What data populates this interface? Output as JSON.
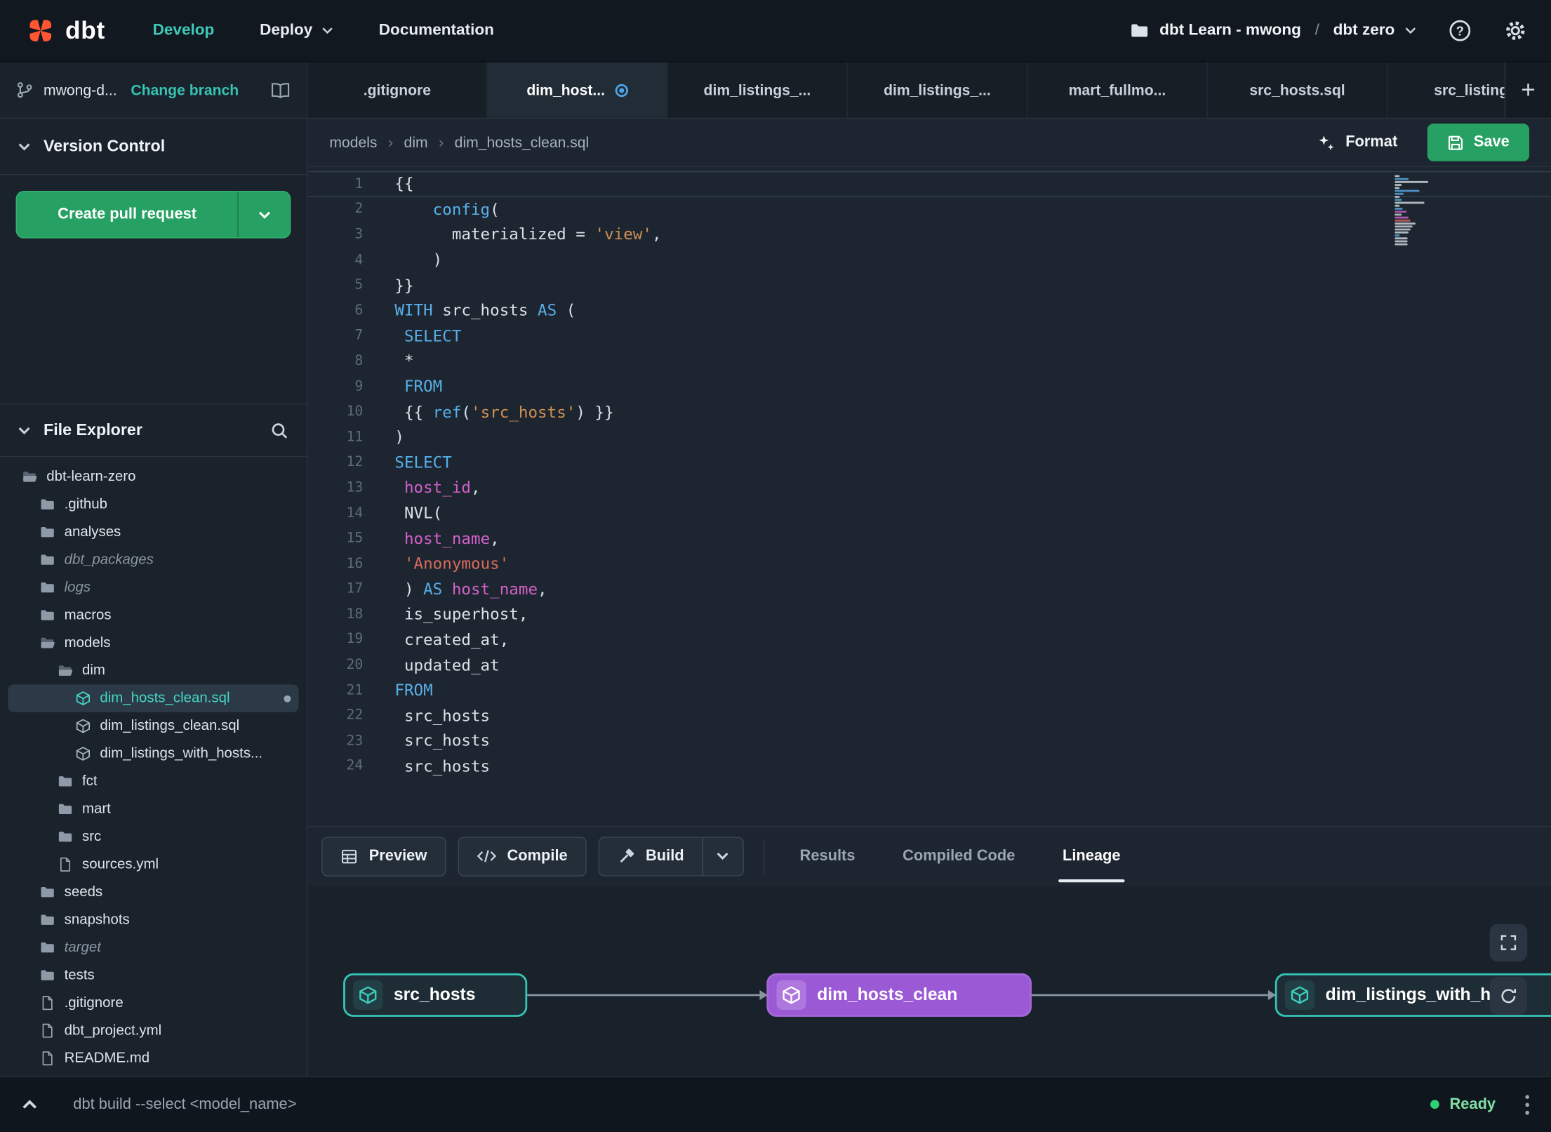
{
  "topnav": {
    "logo": "dbt",
    "develop": "Develop",
    "deploy": "Deploy",
    "documentation": "Documentation",
    "account": "dbt Learn - mwong",
    "separator": "/",
    "project": "dbt zero"
  },
  "sidebar": {
    "branch_name": "mwong-d...",
    "change_branch": "Change branch",
    "version_control": "Version Control",
    "create_pull_request": "Create pull request",
    "file_explorer": "File Explorer",
    "file_tree": [
      {
        "label": "dbt-learn-zero",
        "icon": "folderOpen",
        "indent": 0
      },
      {
        "label": ".github",
        "icon": "folder",
        "indent": 1
      },
      {
        "label": "analyses",
        "icon": "folder",
        "indent": 1
      },
      {
        "label": "dbt_packages",
        "icon": "folder",
        "indent": 1,
        "muted": true
      },
      {
        "label": "logs",
        "icon": "folder",
        "indent": 1,
        "muted": true
      },
      {
        "label": "macros",
        "icon": "folder",
        "indent": 1
      },
      {
        "label": "models",
        "icon": "folderOpen",
        "indent": 1
      },
      {
        "label": "dim",
        "icon": "folderOpen",
        "indent": 2
      },
      {
        "label": "dim_hosts_clean.sql",
        "icon": "model",
        "indent": 3,
        "selected": true,
        "unsaved": true
      },
      {
        "label": "dim_listings_clean.sql",
        "icon": "model",
        "indent": 3
      },
      {
        "label": "dim_listings_with_hosts...",
        "icon": "model",
        "indent": 3
      },
      {
        "label": "fct",
        "icon": "folder",
        "indent": 2
      },
      {
        "label": "mart",
        "icon": "folder",
        "indent": 2
      },
      {
        "label": "src",
        "icon": "folder",
        "indent": 2
      },
      {
        "label": "sources.yml",
        "icon": "file",
        "indent": 2
      },
      {
        "label": "seeds",
        "icon": "folder",
        "indent": 1
      },
      {
        "label": "snapshots",
        "icon": "folder",
        "indent": 1
      },
      {
        "label": "target",
        "icon": "folder",
        "indent": 1,
        "muted": true
      },
      {
        "label": "tests",
        "icon": "folder",
        "indent": 1
      },
      {
        "label": ".gitignore",
        "icon": "file",
        "indent": 1
      },
      {
        "label": "dbt_project.yml",
        "icon": "file",
        "indent": 1
      },
      {
        "label": "README.md",
        "icon": "file",
        "indent": 1
      }
    ]
  },
  "tabs": [
    {
      "label": ".gitignore"
    },
    {
      "label": "dim_host...",
      "active": true,
      "unsaved": true
    },
    {
      "label": "dim_listings_..."
    },
    {
      "label": "dim_listings_..."
    },
    {
      "label": "mart_fullmo..."
    },
    {
      "label": "src_hosts.sql"
    },
    {
      "label": "src_listings."
    }
  ],
  "breadcrumb": [
    "models",
    "dim",
    "dim_hosts_clean.sql"
  ],
  "actions": {
    "format": "Format",
    "save": "Save"
  },
  "editor": {
    "lines": [
      [
        [
          "{{",
          "p"
        ]
      ],
      [
        [
          "    ",
          "p"
        ],
        [
          "config",
          "k"
        ],
        [
          "(",
          "p"
        ]
      ],
      [
        [
          "      materialized = ",
          "p"
        ],
        [
          "'view'",
          "s"
        ],
        [
          ",",
          "p"
        ]
      ],
      [
        [
          "    )",
          "p"
        ]
      ],
      [
        [
          "}}",
          "p"
        ]
      ],
      [
        [
          "WITH",
          "k"
        ],
        [
          " src_hosts ",
          "p"
        ],
        [
          "AS",
          "k"
        ],
        [
          " (",
          "p"
        ]
      ],
      [
        [
          " ",
          "p"
        ],
        [
          "SELECT",
          "k"
        ]
      ],
      [
        [
          " *",
          "p"
        ]
      ],
      [
        [
          " ",
          "p"
        ],
        [
          "FROM",
          "k"
        ]
      ],
      [
        [
          " {{ ",
          "p"
        ],
        [
          "ref",
          "k"
        ],
        [
          "(",
          "p"
        ],
        [
          "'src_hosts'",
          "s"
        ],
        [
          ")",
          "p"
        ],
        [
          " }}",
          "p"
        ]
      ],
      [
        [
          ")",
          "p"
        ]
      ],
      [
        [
          "SELECT",
          "k"
        ]
      ],
      [
        [
          " ",
          "p"
        ],
        [
          "host_id",
          "i"
        ],
        [
          ",",
          "p"
        ]
      ],
      [
        [
          " NVL(",
          "p"
        ]
      ],
      [
        [
          " ",
          "p"
        ],
        [
          "host_name",
          "i"
        ],
        [
          ",",
          "p"
        ]
      ],
      [
        [
          " ",
          "p"
        ],
        [
          "'Anonymous'",
          "r"
        ]
      ],
      [
        [
          " ) ",
          "p"
        ],
        [
          "AS",
          "k"
        ],
        [
          " ",
          "p"
        ],
        [
          "host_name",
          "i"
        ],
        [
          ",",
          "p"
        ]
      ],
      [
        [
          " is_superhost,",
          "p"
        ]
      ],
      [
        [
          " created_at,",
          "p"
        ]
      ],
      [
        [
          " updated_at",
          "p"
        ]
      ],
      [
        [
          "FROM",
          "k"
        ]
      ],
      [
        [
          " src_hosts",
          "p"
        ]
      ],
      [
        [
          " src_hosts",
          "p"
        ]
      ],
      [
        [
          " src_hosts",
          "p"
        ]
      ]
    ]
  },
  "toolbar": {
    "preview": "Preview",
    "compile": "Compile",
    "build": "Build",
    "tabs": [
      {
        "label": "Results"
      },
      {
        "label": "Compiled Code"
      },
      {
        "label": "Lineage",
        "active": true
      }
    ]
  },
  "lineage": {
    "nodes": [
      {
        "label": "src_hosts",
        "style": "teal"
      },
      {
        "label": "dim_hosts_clean",
        "style": "purple"
      },
      {
        "label": "dim_listings_with_hosts",
        "style": "teal"
      }
    ]
  },
  "statusbar": {
    "command": "dbt build --select <model_name>",
    "ready": "Ready"
  }
}
